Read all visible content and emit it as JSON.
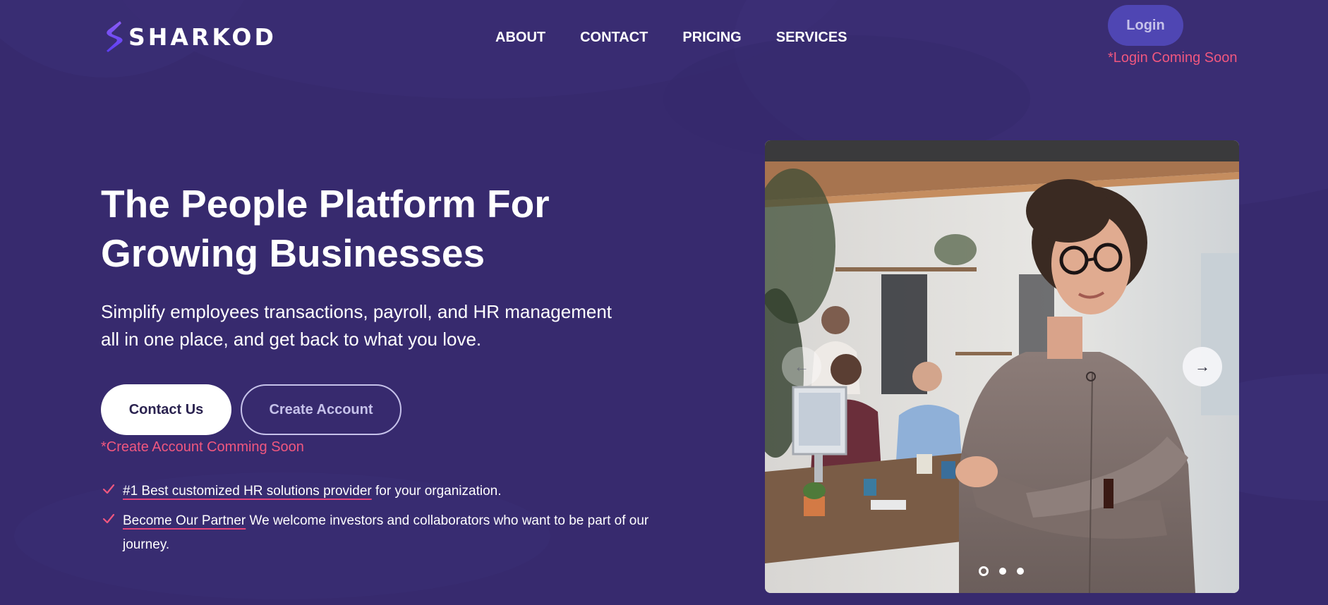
{
  "brand": {
    "name": "SHARKOD",
    "accent": "#f0577f",
    "logo_gradient": [
      "#8b5cf6",
      "#5b3df2"
    ]
  },
  "nav": {
    "items": [
      {
        "label": "ABOUT"
      },
      {
        "label": "CONTACT"
      },
      {
        "label": "PRICING"
      },
      {
        "label": "SERVICES"
      }
    ],
    "login_label": "Login",
    "login_note": "*Login Coming Soon"
  },
  "hero": {
    "title_line1": "The People Platform For",
    "title_line2": "Growing Businesses",
    "subtitle_line1": "Simplify employees transactions, payroll, and HR management",
    "subtitle_line2": "all in one place, and get back to what you love.",
    "contact_label": "Contact Us",
    "create_label": "Create Account",
    "create_note": "*Create Account Comming Soon"
  },
  "features": [
    {
      "link": "#1 Best customized HR solutions provider",
      "text": " for your organization."
    },
    {
      "link": "Become Our Partner",
      "text": " We welcome investors and collaborators who want to be part of our journey."
    }
  ],
  "carousel": {
    "prev_icon": "arrow-left-icon",
    "next_icon": "arrow-right-icon",
    "prev_glyph": "←",
    "next_glyph": "→",
    "slide_count": 3,
    "active_slide": 1
  },
  "colors": {
    "background": "#372a6e",
    "login_button": "#4f46b3",
    "underline": "#e5457a"
  }
}
